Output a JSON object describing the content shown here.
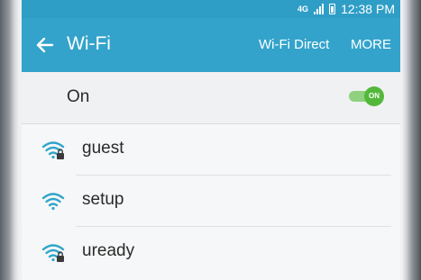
{
  "status_bar": {
    "time": "12:38 PM",
    "network_label": "4G"
  },
  "header": {
    "title": "Wi-Fi",
    "wifi_direct_label": "Wi-Fi Direct",
    "more_label": "MORE"
  },
  "wifi_toggle": {
    "label": "On",
    "switch_text": "ON",
    "enabled": true
  },
  "networks": [
    {
      "name": "guest",
      "secured": true
    },
    {
      "name": "setup",
      "secured": false
    },
    {
      "name": "uready",
      "secured": true
    }
  ],
  "colors": {
    "accent": "#33a3cb",
    "switch_on": "#53b83a",
    "wifi_icon": "#2fa4c9"
  }
}
